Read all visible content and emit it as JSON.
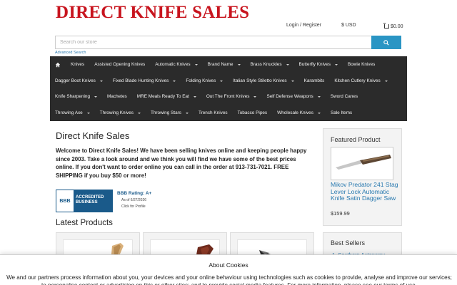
{
  "header": {
    "logo_text": "DIRECT KNIFE SALES",
    "login": "Login / Register",
    "currency": "$ USD",
    "cart": "$0.00"
  },
  "search": {
    "placeholder": "Search our store",
    "advanced": "Advanced Search"
  },
  "menu": {
    "rows": [
      [
        {
          "label": "",
          "icon": "home-icon"
        },
        {
          "label": "Knives"
        },
        {
          "label": "Assisted Opening Knives"
        },
        {
          "label": "Automatic Knives",
          "dropdown": true
        },
        {
          "label": "Brand Name",
          "dropdown": true
        },
        {
          "label": "Brass Knuckles",
          "dropdown": true
        },
        {
          "label": "Butterfly Knives",
          "dropdown": true
        },
        {
          "label": "Bowie Knives"
        }
      ],
      [
        {
          "label": "Dagger Boot Knives",
          "dropdown": true
        },
        {
          "label": "Fixed Blade Hunting Knives",
          "dropdown": true
        },
        {
          "label": "Folding Knives",
          "dropdown": true
        },
        {
          "label": "Italian Style Stiletto Knives",
          "dropdown": true
        },
        {
          "label": "Karambits"
        },
        {
          "label": "Kitchen Cutlery Knives",
          "dropdown": true
        }
      ],
      [
        {
          "label": "Knife Sharpening",
          "dropdown": true
        },
        {
          "label": "Machetes"
        },
        {
          "label": "MRE Meals Ready To Eat",
          "dropdown": true
        },
        {
          "label": "Out The Front Knives",
          "dropdown": true
        },
        {
          "label": "Self Defense Weapons",
          "dropdown": true
        },
        {
          "label": "Sword Canes"
        }
      ],
      [
        {
          "label": "Throwing Axe",
          "dropdown": true
        },
        {
          "label": "Throwing Knives",
          "dropdown": true
        },
        {
          "label": "Throwing Stars",
          "dropdown": true
        },
        {
          "label": "Trench Knives"
        },
        {
          "label": "Tobacco Pipes"
        },
        {
          "label": "Wholesale Knives",
          "dropdown": true
        },
        {
          "label": "Sale Items"
        }
      ]
    ]
  },
  "main": {
    "title": "Direct Knife Sales",
    "welcome": "Welcome to Direct Knife Sales! We have been selling knives online and keeping people happy since 2003. Take a look around and we think you will find we have some of the best prices online.  If you don't want to order online you can call in the order at 913-731-7021. FREE SHIPPING if you buy $50 or more!",
    "bbb": {
      "seal_logo": "BBB",
      "seal_line1": "ACCREDITED",
      "seal_line2": "BUSINESS",
      "rating": "BBB Rating: A+",
      "as_of": "As of 6/27/2026",
      "click": "Click for Profile"
    },
    "latest_title": "Latest Products"
  },
  "sidebar": {
    "featured_title": "Featured Product",
    "featured_name": "Mikov Predator 241 Stag Lever Lock Automatic Knife Satin Dagger Saw",
    "featured_price": "$159.99",
    "bestsellers_title": "Best Sellers",
    "bestseller_1": "1. Southern Autonomy"
  },
  "cookie": {
    "title": "About Cookies",
    "text": "We and our partners process information about you, your devices and your online behaviour using technologies such as cookies to provide, analyse and improve our services; to personalise content or advertising on this or other sites; and to provide social media features. For more information, please see our terms of use."
  },
  "colors": {
    "brand_red": "#c8141e",
    "menu_bg": "#2b2b2b",
    "search_button": "#2a95c4",
    "link": "#2a7ab0"
  }
}
